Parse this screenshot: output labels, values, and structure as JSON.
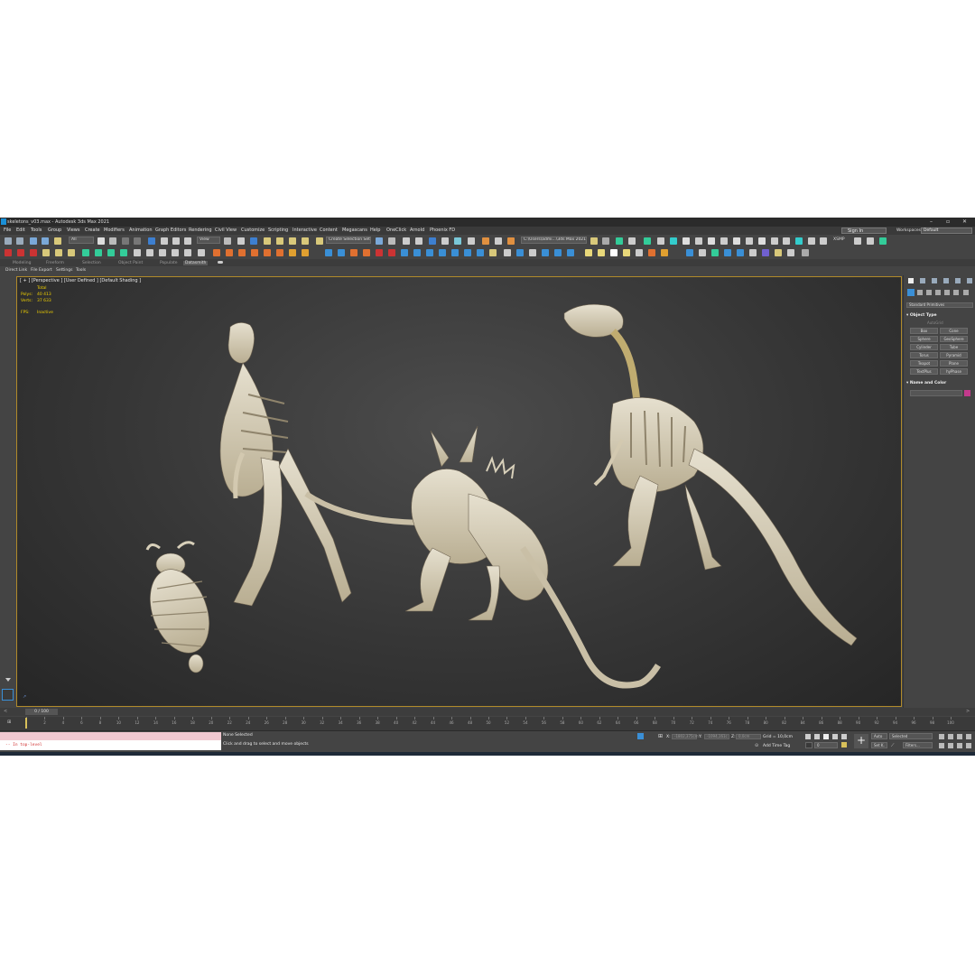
{
  "window": {
    "title": "skeletons_v03.max - Autodesk 3ds Max 2021"
  },
  "menu": [
    "File",
    "Edit",
    "Tools",
    "Group",
    "Views",
    "Create",
    "Modifiers",
    "Animation",
    "Graph Editors",
    "Rendering",
    "Civil View",
    "Customize",
    "Scripting",
    "Interactive",
    "Content",
    "Megascans",
    "Help",
    "OneClick",
    "Arnold",
    "Phoenix FD"
  ],
  "account": {
    "sign_in": "Sign In",
    "workspaces_label": "Workspaces:",
    "workspace": "Default"
  },
  "toolbar": {
    "filter": "All",
    "ref_coord": "View",
    "selection_set": "Create Selection Set",
    "project_path": "C:\\Users\\admi...\\3ds Max 2021",
    "xsmp": "XSMP"
  },
  "ribbon": {
    "tabs": [
      "Modeling",
      "Freeform",
      "Selection",
      "Object Paint",
      "Populate",
      "Datasmith"
    ],
    "sub": [
      "Direct Link",
      "File Export",
      "Settings",
      "Tools"
    ]
  },
  "viewport": {
    "label": "[ + ] [Perspective ] [User Defined ] [Default Shading ]",
    "stats": {
      "total_label": "Total",
      "polys_label": "Polys:",
      "polys": "40 413",
      "verts_label": "Verts:",
      "verts": "37 633",
      "fps_label": "FPS:",
      "fps": "Inactive"
    }
  },
  "command_panel": {
    "category": "Standard Primitives",
    "object_type_title": "Object Type",
    "autogrid": "AutoGrid",
    "primitives": [
      "Box",
      "Cone",
      "Sphere",
      "GeoSphere",
      "Cylinder",
      "Tube",
      "Torus",
      "Pyramid",
      "Teapot",
      "Plane",
      "TextPlus",
      "hyPhase"
    ],
    "name_color_title": "Name and Color",
    "object_color": "#c23a8c"
  },
  "timeline": {
    "frame_label": "0 / 100",
    "ticks": [
      "0",
      "2",
      "4",
      "6",
      "8",
      "10",
      "12",
      "14",
      "16",
      "18",
      "20",
      "22",
      "24",
      "26",
      "28",
      "30",
      "32",
      "34",
      "36",
      "38",
      "40",
      "42",
      "44",
      "46",
      "48",
      "50",
      "52",
      "54",
      "56",
      "58",
      "60",
      "62",
      "64",
      "66",
      "68",
      "70",
      "72",
      "74",
      "76",
      "78",
      "80",
      "82",
      "84",
      "86",
      "88",
      "90",
      "92",
      "94",
      "96",
      "98",
      "100"
    ]
  },
  "status": {
    "maxscript_output": "-- In top-level",
    "selection": "None Selected",
    "prompt": "Click and drag to select and move objects",
    "x_label": "X:",
    "x_value": "-1802,375cm",
    "y_label": "Y:",
    "y_value": "-1094,161c",
    "z_label": "Z:",
    "z_value": "0,0cm",
    "grid": "Grid = 10,0cm",
    "add_time_tag": "Add Time Tag",
    "auto_key": "Auto",
    "set_key": "Set K.",
    "key_filter_sel": "Selected",
    "key_filters": "Filters...",
    "frame_field": "0"
  }
}
